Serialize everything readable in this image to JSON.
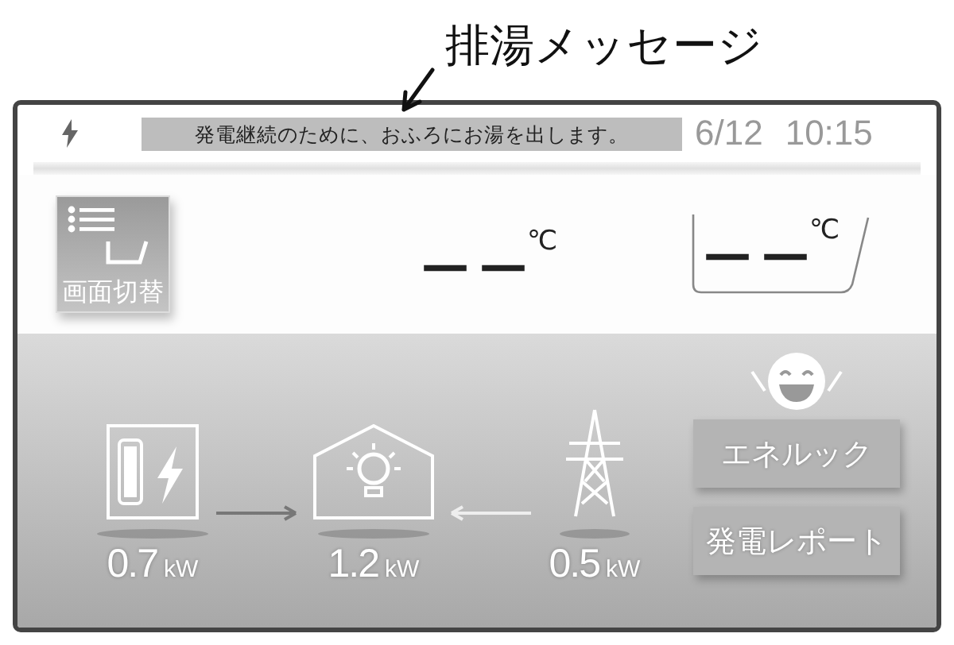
{
  "annotation": {
    "label": "排湯メッセージ"
  },
  "status_bar": {
    "message": "発電継続のために、おふろにお湯を出します。",
    "date": "6/12",
    "time": "10:15"
  },
  "screen_switch_button": {
    "label": "画面切替"
  },
  "temperatures": [
    {
      "kind": "hot_water",
      "value": "— —",
      "unit": "℃"
    },
    {
      "kind": "bath",
      "value": "— —",
      "unit": "℃"
    }
  ],
  "power_flow": [
    {
      "kind": "generation",
      "value": "0.7",
      "unit": "kW"
    },
    {
      "kind": "home",
      "value": "1.2",
      "unit": "kW"
    },
    {
      "kind": "grid",
      "value": "0.5",
      "unit": "kW"
    }
  ],
  "buttons": [
    "エネルック",
    "発電レポート"
  ]
}
